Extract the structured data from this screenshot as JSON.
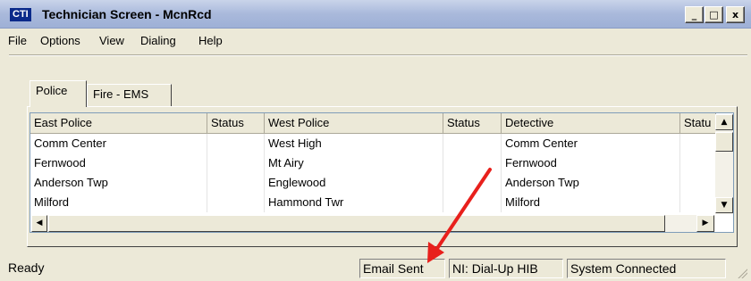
{
  "window": {
    "app_badge": "CTI",
    "title": "Technician Screen - McnRcd",
    "controls": {
      "minimize": "_",
      "maximize": "□",
      "close": "x"
    }
  },
  "menu": [
    "File",
    "Options",
    "View",
    "Dialing",
    "Help"
  ],
  "tabs": [
    "Police",
    "Fire - EMS"
  ],
  "grid": {
    "columns": [
      "East Police",
      "Status",
      "West Police",
      "Status",
      "Detective",
      "Statu"
    ],
    "rows": [
      [
        "Comm Center",
        "",
        "West High",
        "",
        "Comm Center",
        ""
      ],
      [
        "Fernwood",
        "",
        "Mt Airy",
        "",
        "Fernwood",
        ""
      ],
      [
        "Anderson Twp",
        "",
        "Englewood",
        "",
        "Anderson Twp",
        ""
      ],
      [
        "Milford",
        "",
        "Hammond Twr",
        "",
        "Milford",
        ""
      ]
    ]
  },
  "status": {
    "left": "Ready",
    "email": "Email Sent",
    "ni": "NI: Dial-Up HIB",
    "connection": "System Connected"
  },
  "colors": {
    "annotation_arrow": "#e8201c",
    "title_gradient": "#a9b9db",
    "chrome": "#ece9d8"
  },
  "icons": [
    "app-badge-icon",
    "minimize-icon",
    "maximize-icon",
    "close-icon",
    "scroll-up-icon",
    "scroll-down-icon",
    "scroll-left-icon",
    "scroll-right-icon",
    "resize-grip-icon"
  ]
}
